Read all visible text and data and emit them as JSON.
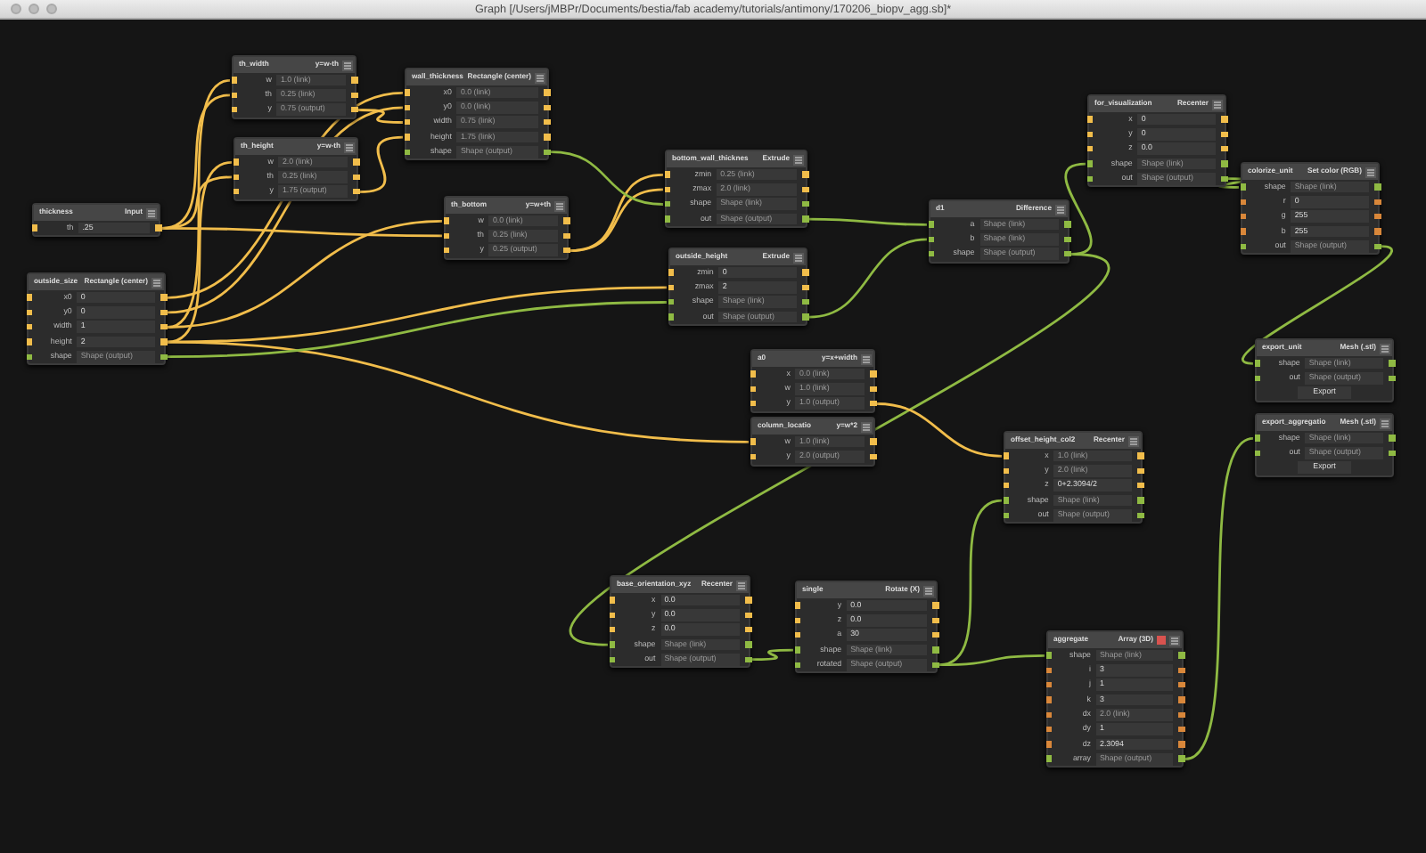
{
  "window": {
    "title": "Graph [/Users/jMBPr/Documents/bestia/fab academy/tutorials/antimony/170206_biopv_agg.sb]*"
  },
  "nodes": [
    {
      "name": "th_width",
      "type": "y=w-th",
      "flagged": false,
      "rows": [
        {
          "label": "w",
          "value": "1.0 (link)",
          "kind": "number",
          "linked": true
        },
        {
          "label": "th",
          "value": "0.25 (link)",
          "kind": "number",
          "linked": true
        },
        {
          "label": "y",
          "value": "0.75 (output)",
          "kind": "number",
          "linked": true
        }
      ]
    },
    {
      "name": "wall_thickness",
      "type": "Rectangle (center)",
      "flagged": false,
      "rows": [
        {
          "label": "x0",
          "value": "0.0 (link)",
          "kind": "number",
          "linked": true
        },
        {
          "label": "y0",
          "value": "0.0 (link)",
          "kind": "number",
          "linked": true
        },
        {
          "label": "width",
          "value": "0.75 (link)",
          "kind": "number",
          "linked": true
        },
        {
          "label": "height",
          "value": "1.75 (link)",
          "kind": "number",
          "linked": true
        },
        {
          "label": "shape",
          "value": "Shape (output)",
          "kind": "shape",
          "linked": true
        }
      ]
    },
    {
      "name": "th_height",
      "type": "y=w-th",
      "flagged": false,
      "rows": [
        {
          "label": "w",
          "value": "2.0 (link)",
          "kind": "number",
          "linked": true
        },
        {
          "label": "th",
          "value": "0.25 (link)",
          "kind": "number",
          "linked": true
        },
        {
          "label": "y",
          "value": "1.75 (output)",
          "kind": "number",
          "linked": true
        }
      ]
    },
    {
      "name": "thickness",
      "type": "Input",
      "flagged": false,
      "rows": [
        {
          "label": "th",
          "value": ".25",
          "kind": "number",
          "linked": false
        }
      ]
    },
    {
      "name": "th_bottom",
      "type": "y=w+th",
      "flagged": false,
      "rows": [
        {
          "label": "w",
          "value": "0.0 (link)",
          "kind": "number",
          "linked": true
        },
        {
          "label": "th",
          "value": "0.25 (link)",
          "kind": "number",
          "linked": true
        },
        {
          "label": "y",
          "value": "0.25 (output)",
          "kind": "number",
          "linked": true
        }
      ]
    },
    {
      "name": "outside_size",
      "type": "Rectangle (center)",
      "flagged": false,
      "rows": [
        {
          "label": "x0",
          "value": "0",
          "kind": "number",
          "linked": false
        },
        {
          "label": "y0",
          "value": "0",
          "kind": "number",
          "linked": false
        },
        {
          "label": "width",
          "value": "1",
          "kind": "number",
          "linked": false
        },
        {
          "label": "height",
          "value": "2",
          "kind": "number",
          "linked": false
        },
        {
          "label": "shape",
          "value": "Shape (output)",
          "kind": "shape",
          "linked": true
        }
      ]
    },
    {
      "name": "bottom_wall_thicknes",
      "type": "Extrude",
      "flagged": false,
      "rows": [
        {
          "label": "zmin",
          "value": "0.25 (link)",
          "kind": "number",
          "linked": true
        },
        {
          "label": "zmax",
          "value": "2.0 (link)",
          "kind": "number",
          "linked": true
        },
        {
          "label": "shape",
          "value": "Shape (link)",
          "kind": "shape",
          "linked": true
        },
        {
          "label": "out",
          "value": "Shape (output)",
          "kind": "shape",
          "linked": true
        }
      ]
    },
    {
      "name": "outside_height",
      "type": "Extrude",
      "flagged": false,
      "rows": [
        {
          "label": "zmin",
          "value": "0",
          "kind": "number",
          "linked": false
        },
        {
          "label": "zmax",
          "value": "2",
          "kind": "number",
          "linked": false
        },
        {
          "label": "shape",
          "value": "Shape (link)",
          "kind": "shape",
          "linked": true
        },
        {
          "label": "out",
          "value": "Shape (output)",
          "kind": "shape",
          "linked": true
        }
      ]
    },
    {
      "name": "d1",
      "type": "Difference",
      "flagged": false,
      "rows": [
        {
          "label": "a",
          "value": "Shape (link)",
          "kind": "shape",
          "linked": true
        },
        {
          "label": "b",
          "value": "Shape (link)",
          "kind": "shape",
          "linked": true
        },
        {
          "label": "shape",
          "value": "Shape (output)",
          "kind": "shape",
          "linked": true
        }
      ]
    },
    {
      "name": "for_visualization",
      "type": "Recenter",
      "flagged": false,
      "rows": [
        {
          "label": "x",
          "value": "0",
          "kind": "number",
          "linked": false
        },
        {
          "label": "y",
          "value": "0",
          "kind": "number",
          "linked": false
        },
        {
          "label": "z",
          "value": "0.0",
          "kind": "number",
          "linked": false
        },
        {
          "label": "shape",
          "value": "Shape (link)",
          "kind": "shape",
          "linked": true
        },
        {
          "label": "out",
          "value": "Shape (output)",
          "kind": "shape",
          "linked": true
        }
      ]
    },
    {
      "name": "colorize_unit",
      "type": "Set color (RGB)",
      "flagged": false,
      "rows": [
        {
          "label": "shape",
          "value": "Shape (link)",
          "kind": "shape",
          "linked": true
        },
        {
          "label": "r",
          "value": "0",
          "kind": "integer",
          "linked": false
        },
        {
          "label": "g",
          "value": "255",
          "kind": "integer",
          "linked": false
        },
        {
          "label": "b",
          "value": "255",
          "kind": "integer",
          "linked": false
        },
        {
          "label": "out",
          "value": "Shape (output)",
          "kind": "shape",
          "linked": true
        }
      ]
    },
    {
      "name": "export_unit",
      "type": "Mesh (.stl)",
      "flagged": false,
      "rows": [
        {
          "label": "shape",
          "value": "Shape (link)",
          "kind": "shape",
          "linked": true
        },
        {
          "label": "out",
          "value": "Shape (output)",
          "kind": "shape",
          "linked": true
        },
        {
          "value": "Export",
          "kind": "button"
        }
      ]
    },
    {
      "name": "export_aggregatio",
      "type": "Mesh (.stl)",
      "flagged": false,
      "rows": [
        {
          "label": "shape",
          "value": "Shape (link)",
          "kind": "shape",
          "linked": true
        },
        {
          "label": "out",
          "value": "Shape (output)",
          "kind": "shape",
          "linked": true
        },
        {
          "value": "Export",
          "kind": "button"
        }
      ]
    },
    {
      "name": "a0",
      "type": "y=x+width",
      "flagged": false,
      "rows": [
        {
          "label": "x",
          "value": "0.0 (link)",
          "kind": "number",
          "linked": true
        },
        {
          "label": "w",
          "value": "1.0 (link)",
          "kind": "number",
          "linked": true
        },
        {
          "label": "y",
          "value": "1.0 (output)",
          "kind": "number",
          "linked": true
        }
      ]
    },
    {
      "name": "column_locatio",
      "type": "y=w*2",
      "flagged": false,
      "rows": [
        {
          "label": "w",
          "value": "1.0 (link)",
          "kind": "number",
          "linked": true
        },
        {
          "label": "y",
          "value": "2.0 (output)",
          "kind": "number",
          "linked": true
        }
      ]
    },
    {
      "name": "offset_height_col2",
      "type": "Recenter",
      "flagged": false,
      "rows": [
        {
          "label": "x",
          "value": "1.0 (link)",
          "kind": "number",
          "linked": true
        },
        {
          "label": "y",
          "value": "2.0 (link)",
          "kind": "number",
          "linked": true
        },
        {
          "label": "z",
          "value": "0+2.3094/2",
          "kind": "number",
          "linked": false
        },
        {
          "label": "shape",
          "value": "Shape (link)",
          "kind": "shape",
          "linked": true
        },
        {
          "label": "out",
          "value": "Shape (output)",
          "kind": "shape",
          "linked": true
        }
      ]
    },
    {
      "name": "base_orientation_xyz",
      "type": "Recenter",
      "flagged": false,
      "rows": [
        {
          "label": "x",
          "value": "0.0",
          "kind": "number",
          "linked": false
        },
        {
          "label": "y",
          "value": "0.0",
          "kind": "number",
          "linked": false
        },
        {
          "label": "z",
          "value": "0.0",
          "kind": "number",
          "linked": false
        },
        {
          "label": "shape",
          "value": "Shape (link)",
          "kind": "shape",
          "linked": true
        },
        {
          "label": "out",
          "value": "Shape (output)",
          "kind": "shape",
          "linked": true
        }
      ]
    },
    {
      "name": "single",
      "type": "Rotate (X)",
      "flagged": false,
      "rows": [
        {
          "label": "y",
          "value": "0.0",
          "kind": "number",
          "linked": false
        },
        {
          "label": "z",
          "value": "0.0",
          "kind": "number",
          "linked": false
        },
        {
          "label": "a",
          "value": "30",
          "kind": "number",
          "linked": false
        },
        {
          "label": "shape",
          "value": "Shape (link)",
          "kind": "shape",
          "linked": true
        },
        {
          "label": "rotated",
          "value": "Shape (output)",
          "kind": "shape",
          "linked": true
        }
      ]
    },
    {
      "name": "aggregate",
      "type": "Array (3D)",
      "flagged": true,
      "rows": [
        {
          "label": "shape",
          "value": "Shape (link)",
          "kind": "shape",
          "linked": true
        },
        {
          "label": "i",
          "value": "3",
          "kind": "integer",
          "linked": false
        },
        {
          "label": "j",
          "value": "1",
          "kind": "integer",
          "linked": false
        },
        {
          "label": "k",
          "value": "3",
          "kind": "integer",
          "linked": false
        },
        {
          "label": "dx",
          "value": "2.0 (link)",
          "kind": "integer",
          "linked": true
        },
        {
          "label": "dy",
          "value": "1",
          "kind": "integer",
          "linked": false
        },
        {
          "label": "dz",
          "value": "2.3094",
          "kind": "integer",
          "linked": false
        },
        {
          "label": "array",
          "value": "Shape (output)",
          "kind": "shape",
          "linked": true
        }
      ]
    }
  ]
}
